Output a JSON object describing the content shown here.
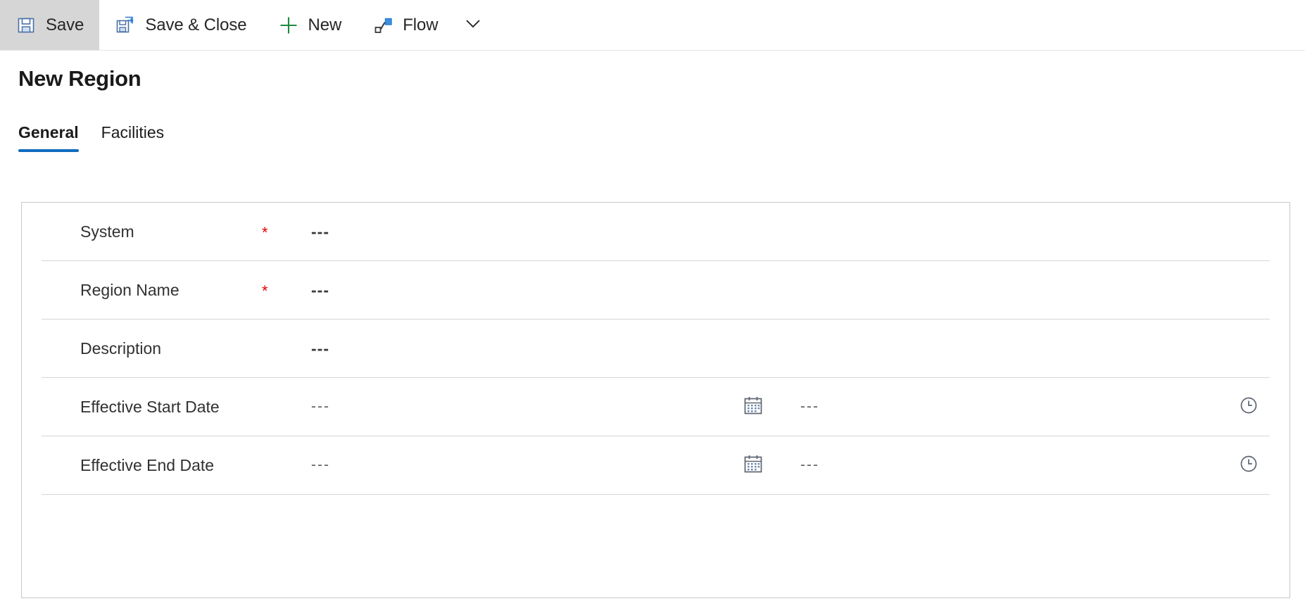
{
  "command_bar": {
    "buttons": [
      {
        "label": "Save",
        "icon": "save-icon",
        "active": true
      },
      {
        "label": "Save & Close",
        "icon": "save-and-close-icon",
        "active": false
      },
      {
        "label": "New",
        "icon": "plus-icon",
        "active": false
      },
      {
        "label": "Flow",
        "icon": "flow-icon",
        "active": false
      }
    ],
    "overflow_icon": "chevron-down-icon"
  },
  "page": {
    "title": "New Region"
  },
  "tabs": [
    {
      "label": "General",
      "selected": true
    },
    {
      "label": "Facilities",
      "selected": false
    }
  ],
  "form": {
    "rows": [
      {
        "label": "System",
        "required": true,
        "value": "---",
        "type": "text"
      },
      {
        "label": "Region Name",
        "required": true,
        "value": "---",
        "type": "text"
      },
      {
        "label": "Description",
        "required": false,
        "value": "---",
        "type": "text"
      },
      {
        "label": "Effective Start Date",
        "required": false,
        "value": "---",
        "time_value": "---",
        "type": "datetime",
        "date_icon": "calendar-icon",
        "time_icon": "clock-icon"
      },
      {
        "label": "Effective End Date",
        "required": false,
        "value": "---",
        "time_value": "---",
        "type": "datetime",
        "date_icon": "calendar-icon",
        "time_icon": "clock-icon"
      }
    ],
    "required_marker": "*"
  },
  "colors": {
    "accent": "#0f6cbd",
    "required": "#e30000",
    "icon_blue": "#2b7cd3",
    "icon_green": "#1d8a3f",
    "active_button_bg": "#d6d6d6",
    "card_border": "#c8c8c8",
    "divider": "#d6d6d6"
  }
}
